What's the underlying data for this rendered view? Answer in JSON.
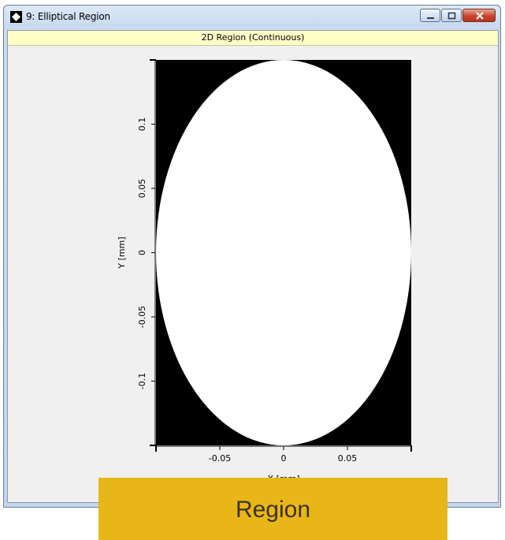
{
  "window": {
    "title": "9: Elliptical Region",
    "icons": [
      "app-icon",
      "minimize-icon",
      "restore-icon",
      "close-icon"
    ]
  },
  "header": {
    "label": "2D Region (Continuous)"
  },
  "chart_data": {
    "type": "heatmap",
    "description_values": "binary region mask: inside ellipse = 1 (white), outside = 0 (black)",
    "xlabel": "X [mm]",
    "ylabel": "Y [mm]",
    "xlim": [
      -0.1,
      0.1
    ],
    "ylim": [
      -0.15,
      0.15
    ],
    "xticks": [
      -0.05,
      0,
      0.05
    ],
    "xtick_labels": [
      "-0.05",
      "0",
      "0.05"
    ],
    "yticks": [
      0.1,
      0.05,
      0,
      -0.05,
      -0.1
    ],
    "ytick_labels": [
      "0.1",
      "0.05",
      "0",
      "-0.05",
      "-0.1"
    ],
    "ellipse": {
      "cx": 0,
      "cy": 0,
      "rx": 0.1,
      "ry": 0.15
    },
    "colors": {
      "inside": "#ffffff",
      "outside": "#000000"
    }
  },
  "overlay": {
    "label": "Region",
    "color": "#e8b616"
  }
}
